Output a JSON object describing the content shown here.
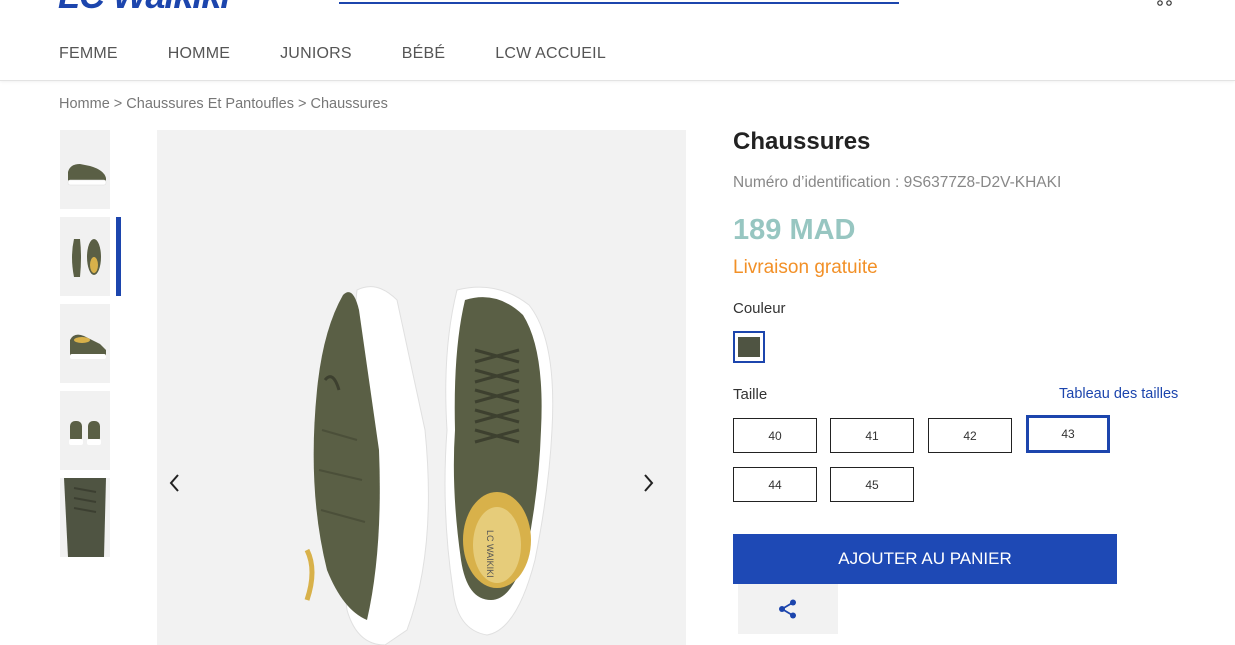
{
  "brand": {
    "logo_text": "LC Waikiki"
  },
  "nav": {
    "items": [
      "FEMME",
      "HOMME",
      "JUNIORS",
      "BÉBÉ",
      "LCW ACCUEIL"
    ]
  },
  "breadcrumb": {
    "items": [
      "Homme",
      "Chaussures Et Pantoufles",
      "Chaussures"
    ],
    "separator": " > "
  },
  "product": {
    "title": "Chaussures",
    "identification": "Numéro d’identification : 9S6377Z8-D2V-KHAKI",
    "price": "189 MAD",
    "shipping": "Livraison gratuite",
    "color_label": "Couleur",
    "color_swatch": "#4f5442",
    "size_label": "Taille",
    "size_chart_link": "Tableau des tailles",
    "sizes": [
      "40",
      "41",
      "42",
      "43",
      "44",
      "45"
    ],
    "selected_size": "43",
    "add_to_cart": "AJOUTER AU PANIER"
  },
  "gallery": {
    "thumbnail_count": 5,
    "active_thumbnail": 2
  },
  "colors": {
    "brand_blue": "#1c45ad",
    "price_teal": "#97c6c1",
    "shipping_orange": "#f29027"
  },
  "icons": {
    "prev": "chevron-left-icon",
    "next": "chevron-right-icon",
    "share": "share-icon",
    "cart": "cart-icon"
  }
}
